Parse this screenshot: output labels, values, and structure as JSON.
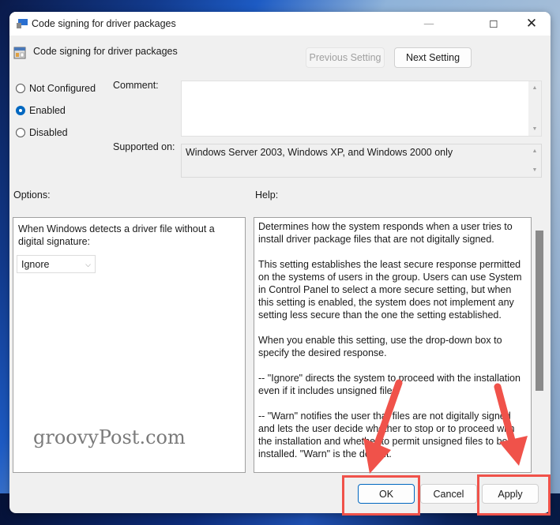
{
  "window": {
    "title": "Code signing for driver packages",
    "controls": {
      "minimize": "—",
      "maximize": "☐",
      "close": "✕"
    }
  },
  "header": {
    "setting_title": "Code signing for driver packages",
    "previous_setting": "Previous Setting",
    "next_setting": "Next Setting"
  },
  "state": {
    "options": [
      {
        "label": "Not Configured",
        "checked": false
      },
      {
        "label": "Enabled",
        "checked": true
      },
      {
        "label": "Disabled",
        "checked": false
      }
    ]
  },
  "comment": {
    "label": "Comment:",
    "value": ""
  },
  "supported": {
    "label": "Supported on:",
    "value": "Windows Server 2003, Windows XP, and Windows 2000 only"
  },
  "options_panel": {
    "label": "Options:",
    "description": "When Windows detects a driver file without a digital signature:",
    "dropdown_value": "Ignore"
  },
  "help_panel": {
    "label": "Help:",
    "paragraphs": [
      "Determines how the system responds when a user tries to install driver package files that are not digitally signed.",
      "This setting establishes the least secure response permitted on the systems of users in the group. Users can use System in Control Panel to select a more secure setting, but when this setting is enabled, the system does not implement any setting less secure than the one the setting established.",
      "When you enable this setting, use the drop-down box to specify the desired response.",
      "--   \"Ignore\" directs the system to proceed with the installation even if it includes unsigned files.",
      "--   \"Warn\" notifies the user that files are not digitally signed and lets the user decide whether to stop or to proceed with the installation and whether to permit unsigned files to be installed. \"Warn\" is the default."
    ]
  },
  "footer": {
    "ok": "OK",
    "cancel": "Cancel",
    "apply": "Apply"
  },
  "annotation": {
    "watermark": "groovyPost.com",
    "highlight_color": "#f0524a"
  }
}
